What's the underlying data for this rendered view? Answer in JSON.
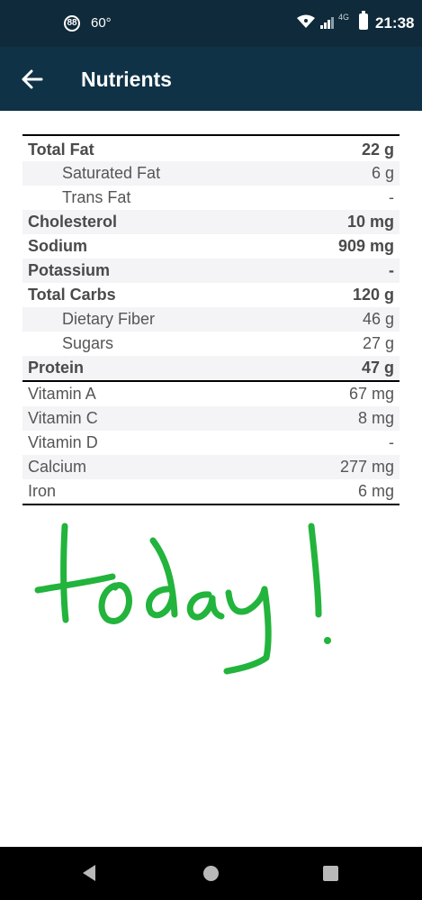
{
  "status_bar": {
    "badge": "88",
    "temperature": "60°",
    "network": "4G",
    "time": "21:38"
  },
  "app_bar": {
    "title": "Nutrients",
    "back_icon": "arrow-left-icon"
  },
  "nutrients": {
    "macros": [
      {
        "label": "Total Fat",
        "value": "22 g"
      },
      {
        "label": "Saturated Fat",
        "value": "6 g"
      },
      {
        "label": "Trans Fat",
        "value": "-"
      },
      {
        "label": "Cholesterol",
        "value": "10 mg"
      },
      {
        "label": "Sodium",
        "value": "909 mg"
      },
      {
        "label": "Potassium",
        "value": "-"
      },
      {
        "label": "Total Carbs",
        "value": "120 g"
      },
      {
        "label": "Dietary Fiber",
        "value": "46 g"
      },
      {
        "label": "Sugars",
        "value": "27 g"
      },
      {
        "label": "Protein",
        "value": "47 g"
      }
    ],
    "micros": [
      {
        "label": "Vitamin A",
        "value": "67 mg"
      },
      {
        "label": "Vitamin C",
        "value": "8 mg"
      },
      {
        "label": "Vitamin D",
        "value": "-"
      },
      {
        "label": "Calcium",
        "value": "277 mg"
      },
      {
        "label": "Iron",
        "value": "6 mg"
      }
    ]
  },
  "annotation": {
    "text": "today!",
    "color": "#22b43c"
  },
  "nav_bar": {
    "back_icon": "triangle-back-icon",
    "home_icon": "circle-home-icon",
    "recents_icon": "square-recents-icon"
  }
}
